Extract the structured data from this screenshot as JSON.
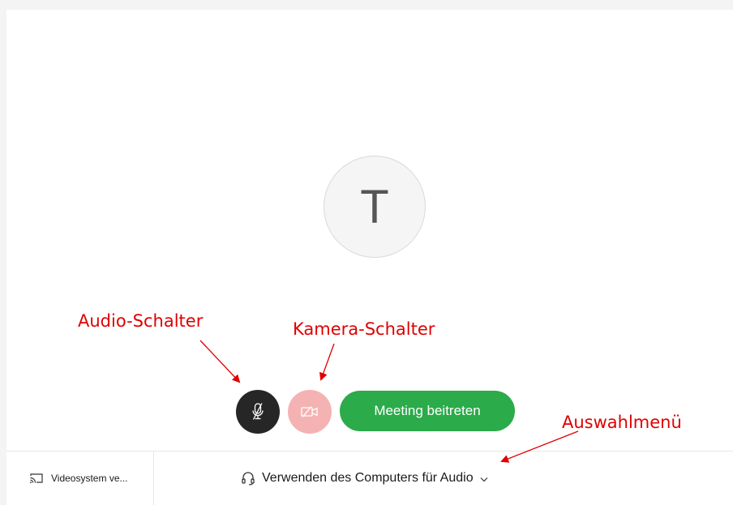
{
  "avatar": {
    "initial": "T"
  },
  "controls": {
    "mic_icon": "microphone-muted-icon",
    "camera_icon": "camera-off-icon",
    "join_label": "Meeting beitreten"
  },
  "bottom_bar": {
    "video_system_icon": "cast-screen-icon",
    "video_system_label": "Videosystem ve...",
    "audio_icon": "headset-icon",
    "audio_label": "Verwenden des Computers für Audio",
    "audio_chevron_icon": "chevron-down-icon"
  },
  "annotations": {
    "audio_switch": "Audio-Schalter",
    "camera_switch": "Kamera-Schalter",
    "selection_menu": "Auswahlmenü"
  },
  "colors": {
    "join_green": "#2bab49",
    "mic_dark": "#262626",
    "camera_pink": "#f5b2b2",
    "annotation_red": "#e00000"
  }
}
